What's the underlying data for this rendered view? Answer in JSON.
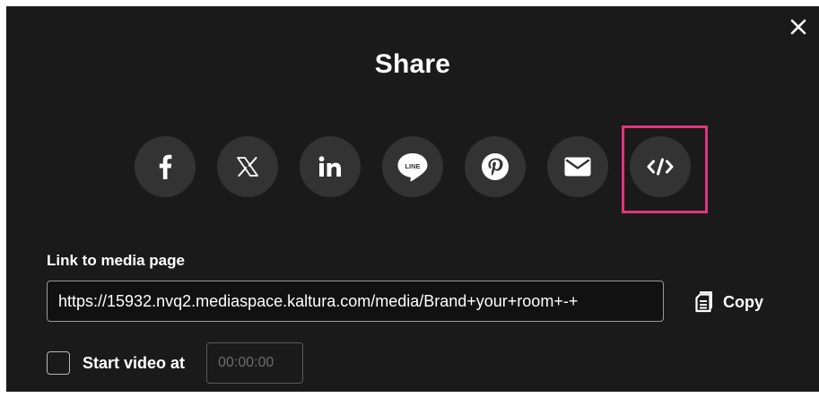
{
  "dialog": {
    "title": "Share",
    "close_icon": "close-icon"
  },
  "social": [
    {
      "name": "facebook",
      "icon": "facebook-icon"
    },
    {
      "name": "x",
      "icon": "x-icon"
    },
    {
      "name": "linkedin",
      "icon": "linkedin-icon"
    },
    {
      "name": "line",
      "icon": "line-icon",
      "icon_text": "LINE"
    },
    {
      "name": "pinterest",
      "icon": "pinterest-icon"
    },
    {
      "name": "email",
      "icon": "email-icon"
    },
    {
      "name": "embed",
      "icon": "embed-icon",
      "highlighted": true
    }
  ],
  "link": {
    "label": "Link to media page",
    "value": "https://15932.nvq2.mediaspace.kaltura.com/media/Brand+your+room+-+",
    "copy_label": "Copy",
    "copy_icon": "copy-icon"
  },
  "start": {
    "label": "Start video at",
    "checked": false,
    "placeholder": "00:00:00"
  },
  "colors": {
    "background": "#1a1a1a",
    "button": "#333333",
    "highlight": "#e0357a",
    "text": "#ffffff"
  }
}
